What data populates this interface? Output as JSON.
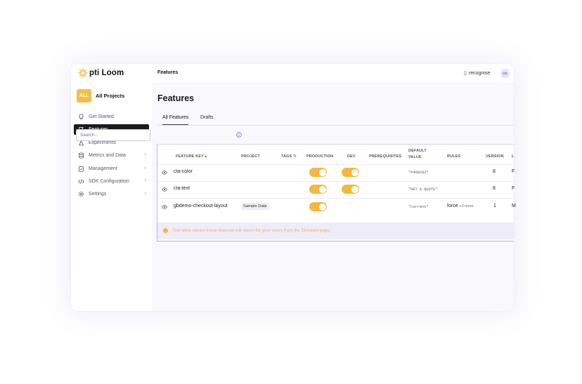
{
  "app": {
    "logo_text": "pti Loom",
    "project_badge": "ALL",
    "project_name": "All Projects",
    "org_name": "recognise",
    "avatar_initials": "OS"
  },
  "sidebar": {
    "items": [
      {
        "label": "Get Started",
        "icon": "lightbulb-icon",
        "active": false,
        "chevron": false
      },
      {
        "label": "Features",
        "icon": "flag-icon",
        "active": true,
        "chevron": false
      },
      {
        "label": "Experiments",
        "icon": "flask-icon",
        "active": false,
        "chevron": false
      },
      {
        "label": "Metrics and Data",
        "icon": "database-icon",
        "active": false,
        "chevron": true
      },
      {
        "label": "Management",
        "icon": "clipboard-icon",
        "active": false,
        "chevron": true
      },
      {
        "label": "SDK Configuration",
        "icon": "code-icon",
        "active": false,
        "chevron": true
      },
      {
        "label": "Settings",
        "icon": "gear-icon",
        "active": false,
        "chevron": true
      }
    ]
  },
  "header": {
    "breadcrumb": "Features"
  },
  "main": {
    "title": "Features",
    "tabs": [
      {
        "label": "All Features",
        "active": true
      },
      {
        "label": "Drafts",
        "active": false
      }
    ],
    "search": {
      "placeholder": "Search..."
    }
  },
  "table": {
    "headers": {
      "feature_key": "FEATURE KEY",
      "project": "PROJECT",
      "tags": "TAGS",
      "production": "PRODUCTION",
      "dev": "DEV",
      "prerequisites": "PREREQUISITES",
      "default_value_1": "DEFAULT",
      "default_value_2": "VALUE",
      "rules": "RULES",
      "version": "VERSION",
      "last": "L"
    },
    "rows": [
      {
        "key": "cta-color",
        "project": "",
        "production": true,
        "dev": true,
        "default_value": "\"#408292\"",
        "rules": "",
        "rules_more": "",
        "version": "8",
        "last": "F"
      },
      {
        "key": "cta-text",
        "project": "",
        "production": true,
        "dev": true,
        "default_value": "\"GET A QUOTE\"",
        "rules": "",
        "rules_more": "",
        "version": "8",
        "last": "F"
      },
      {
        "key": "gbdemo-checkout-layout",
        "project": "Sample Data",
        "production": true,
        "dev": false,
        "default_value": "\"current\"",
        "rules": "force",
        "rules_more": "+3 more",
        "version": "1",
        "last": "M"
      }
    ],
    "banner": "Test what values these features will return for your users from the Simulate page."
  },
  "colors": {
    "accent": "#f6b73c",
    "active_nav": "#1b1b1f",
    "banner_bg": "#efecfb",
    "badge": "#f6be45"
  }
}
